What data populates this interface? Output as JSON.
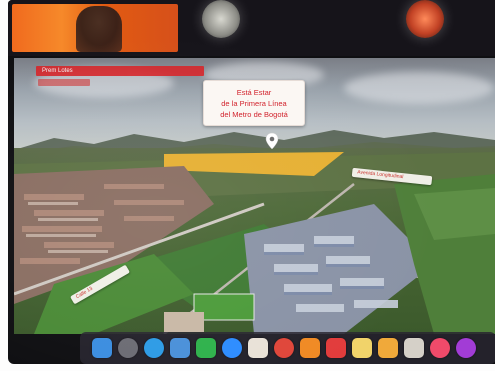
{
  "meeting": {
    "participant_tiles": [
      {
        "kind": "video",
        "color": "#f06a1e"
      },
      {
        "kind": "avatar",
        "color": "#9a9a94"
      },
      {
        "kind": "avatar",
        "color": "#c8452a"
      }
    ]
  },
  "scene": {
    "header_bar_text": "Prem Lotes",
    "callout": {
      "lines": [
        "Está Estar",
        "de la Primera Línea",
        "del Metro de Bogotá"
      ],
      "accent_color": "#d11e28"
    },
    "pin_icon": "location-pin-icon",
    "road_label_right": "Avenida Longitudinal",
    "road_label_left": "Calle 13"
  },
  "dock": {
    "apps": [
      {
        "icon": "finder-icon",
        "color": "#3b8de0"
      },
      {
        "icon": "launchpad-icon",
        "color": "#6c6c74"
      },
      {
        "icon": "safari-icon",
        "color": "#2d9be6"
      },
      {
        "icon": "mail-icon",
        "color": "#4a90d9"
      },
      {
        "icon": "facetime-icon",
        "color": "#2fb24c"
      },
      {
        "icon": "zoom-icon",
        "color": "#2d8cff"
      },
      {
        "icon": "photos-icon",
        "color": "#e9e2d7"
      },
      {
        "icon": "chrome-icon",
        "color": "#e0463a"
      },
      {
        "icon": "books-icon",
        "color": "#f08a24"
      },
      {
        "icon": "calendar-icon",
        "color": "#e23c3c"
      },
      {
        "icon": "notes-icon",
        "color": "#f1d36a"
      },
      {
        "icon": "pages-icon",
        "color": "#f0a93a"
      },
      {
        "icon": "preview-icon",
        "color": "#d5d0c8"
      },
      {
        "icon": "music-icon",
        "color": "#f04a6a"
      },
      {
        "icon": "podcasts-icon",
        "color": "#a23cd6"
      }
    ]
  }
}
